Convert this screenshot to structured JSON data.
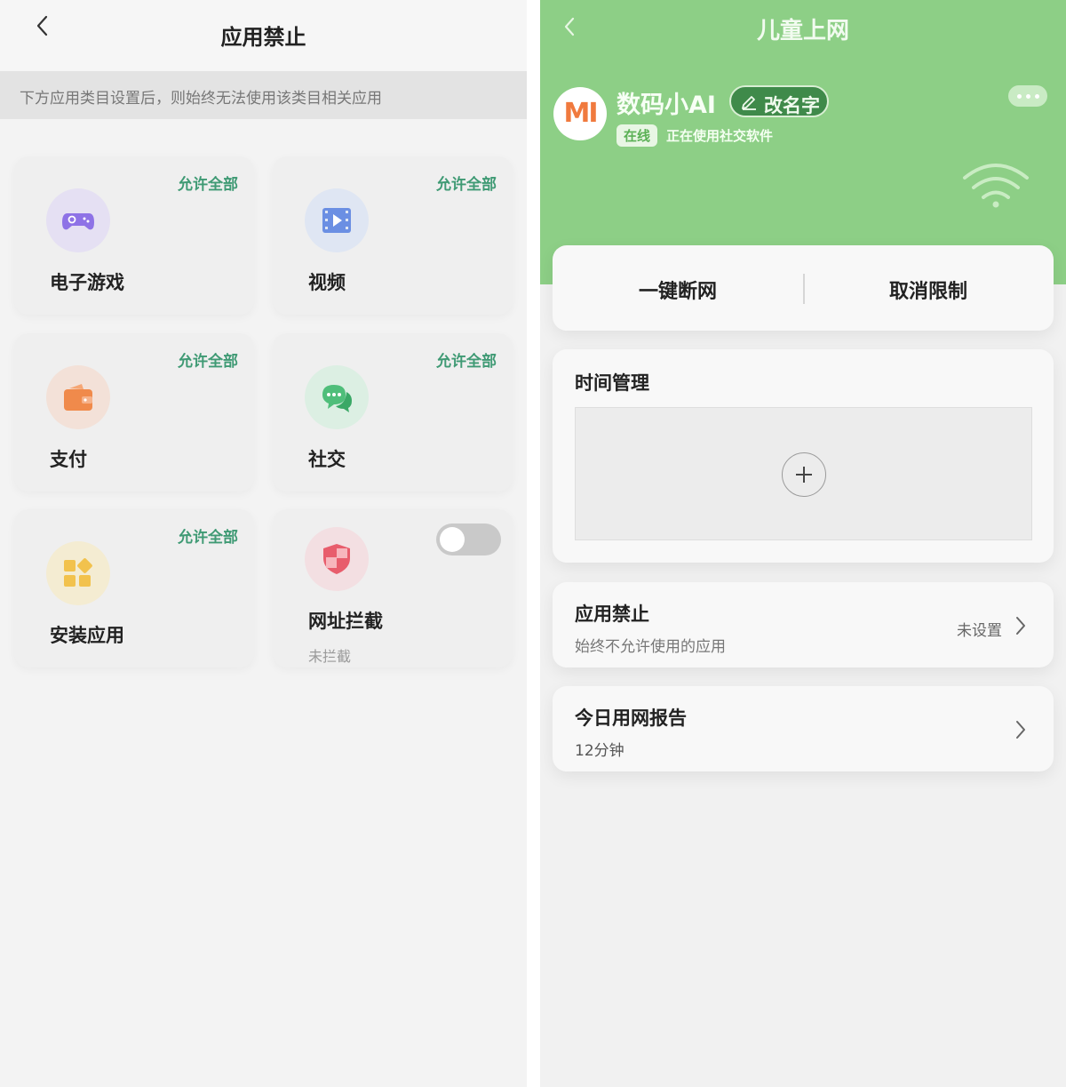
{
  "left": {
    "title": "应用禁止",
    "notice": "下方应用类目设置后，则始终无法使用该类目相关应用",
    "categories": [
      {
        "name": "电子游戏",
        "action": "允许全部",
        "icon": "gamepad-icon",
        "color": "#8e72e6"
      },
      {
        "name": "视频",
        "action": "允许全部",
        "icon": "video-icon",
        "color": "#6b8fe3"
      },
      {
        "name": "支付",
        "action": "允许全部",
        "icon": "wallet-icon",
        "color": "#f08a4b"
      },
      {
        "name": "社交",
        "action": "允许全部",
        "icon": "chat-icon",
        "color": "#4fbe7a"
      },
      {
        "name": "安装应用",
        "action": "允许全部",
        "icon": "apps-icon",
        "color": "#f2c24d"
      }
    ],
    "url_block": {
      "name": "网址拦截",
      "status": "未拦截",
      "icon": "shield-icon",
      "color": "#e85d6c",
      "enabled": false
    }
  },
  "right": {
    "title": "儿童上网",
    "device": {
      "logo": "mi",
      "name": "数码小AI",
      "rename_label": "改名字",
      "status_badge": "在线",
      "status_text": "正在使用社交软件"
    },
    "actions": {
      "disconnect": "一键断网",
      "cancel_limit": "取消限制"
    },
    "time_management": {
      "title": "时间管理"
    },
    "app_block": {
      "title": "应用禁止",
      "subtitle": "始终不允许使用的应用",
      "value": "未设置"
    },
    "report": {
      "title": "今日用网报告",
      "value": "12分钟"
    },
    "colors": {
      "header": "#8dcf86",
      "accent": "#3f9a74"
    }
  }
}
